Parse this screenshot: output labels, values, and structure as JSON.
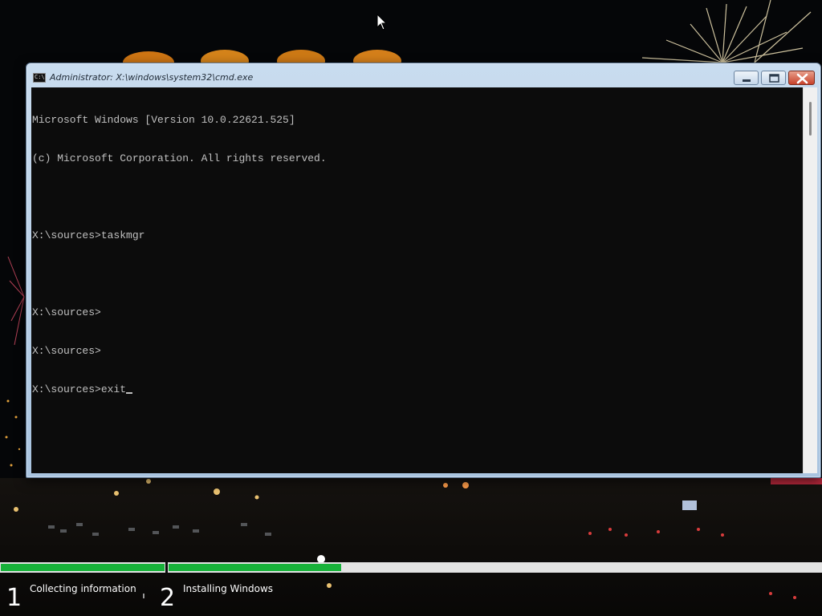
{
  "window": {
    "title": "Administrator: X:\\windows\\system32\\cmd.exe",
    "icon_text": "C:\\.",
    "buttons": [
      "minimize",
      "maximize",
      "close"
    ]
  },
  "console": {
    "lines": [
      "Microsoft Windows [Version 10.0.22621.525]",
      "(c) Microsoft Corporation. All rights reserved.",
      "",
      "X:\\sources>taskmgr",
      "",
      "X:\\sources>",
      "X:\\sources>",
      "X:\\sources>exit"
    ],
    "text_color": "#c0c0c0",
    "background": "#0c0c0c"
  },
  "setup_progress": {
    "steps": [
      {
        "number": "1",
        "label": "Collecting information",
        "progress": 1.0
      },
      {
        "number": "2",
        "label": "Installing Windows",
        "progress": 0.265
      }
    ],
    "fill_color": "#18b23a",
    "track_color": "#e3e3e3"
  }
}
